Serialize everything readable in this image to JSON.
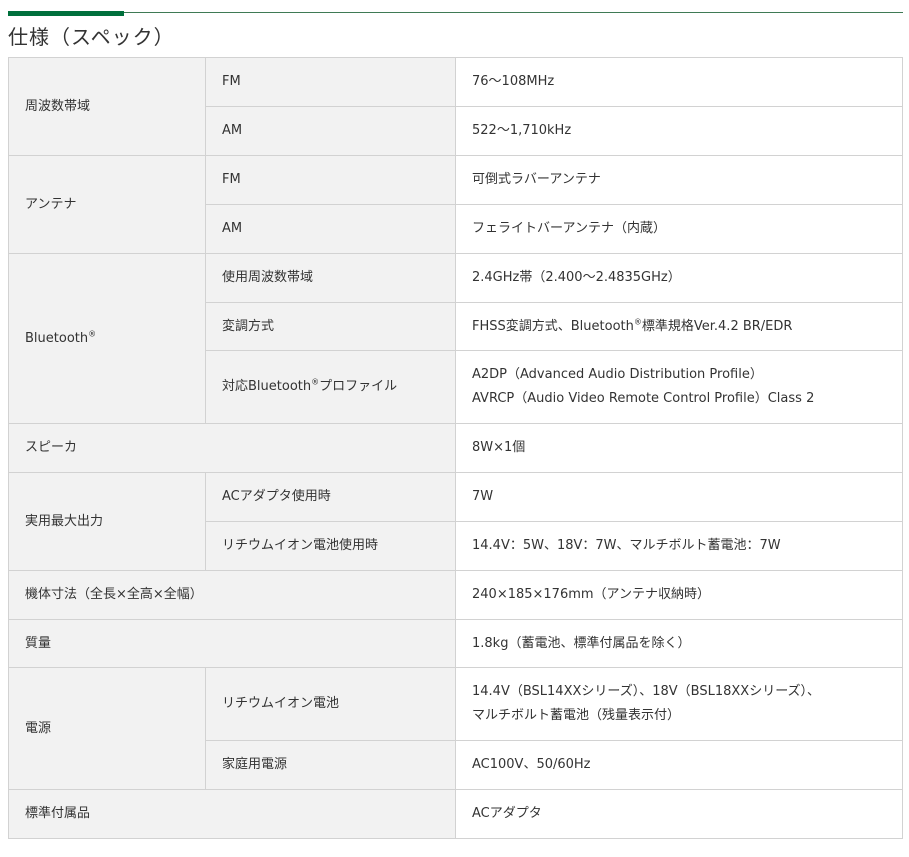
{
  "title": "仕様（スペック）",
  "table": {
    "freq": {
      "label": "周波数帯域",
      "fm_label": "FM",
      "fm_value": "76～108MHz",
      "am_label": "AM",
      "am_value": "522～1,710kHz"
    },
    "antenna": {
      "label": "アンテナ",
      "fm_label": "FM",
      "fm_value": "可倒式ラバーアンテナ",
      "am_label": "AM",
      "am_value": "フェライトバーアンテナ（内蔵）"
    },
    "bluetooth": {
      "label": "Bluetooth",
      "reg": "®",
      "band_label": "使用周波数帯域",
      "band_value": "2.4GHz帯（2.400～2.4835GHz）",
      "modulation_label": "変調方式",
      "modulation_value_a": "FHSS変調方式、Bluetooth",
      "modulation_value_b": "標準規格Ver.4.2 BR/EDR",
      "profile_label_a": "対応Bluetooth",
      "profile_label_b": "プロファイル",
      "profile_value_1": "A2DP（Advanced Audio Distribution Profile）",
      "profile_value_2": "AVRCP（Audio Video Remote Control Profile）Class 2"
    },
    "speaker": {
      "label": "スピーカ",
      "value": "8W×1個"
    },
    "output": {
      "label": "実用最大出力",
      "ac_label": "ACアダプタ使用時",
      "ac_value": "7W",
      "battery_label": "リチウムイオン電池使用時",
      "battery_value": "14.4V：5W、18V：7W、マルチボルト蓄電池：7W"
    },
    "dimensions": {
      "label": "機体寸法（全長×全高×全幅）",
      "value": "240×185×176mm（アンテナ収納時）"
    },
    "weight": {
      "label": "質量",
      "value": "1.8kg（蓄電池、標準付属品を除く）"
    },
    "power": {
      "label": "電源",
      "battery_label": "リチウムイオン電池",
      "battery_value_1": "14.4V（BSL14XXシリーズ）、18V（BSL18XXシリーズ）、",
      "battery_value_2": "マルチボルト蓄電池（残量表示付）",
      "household_label": "家庭用電源",
      "household_value": "AC100V、50/60Hz"
    },
    "accessories": {
      "label": "標準付属品",
      "value": "ACアダプタ"
    }
  }
}
